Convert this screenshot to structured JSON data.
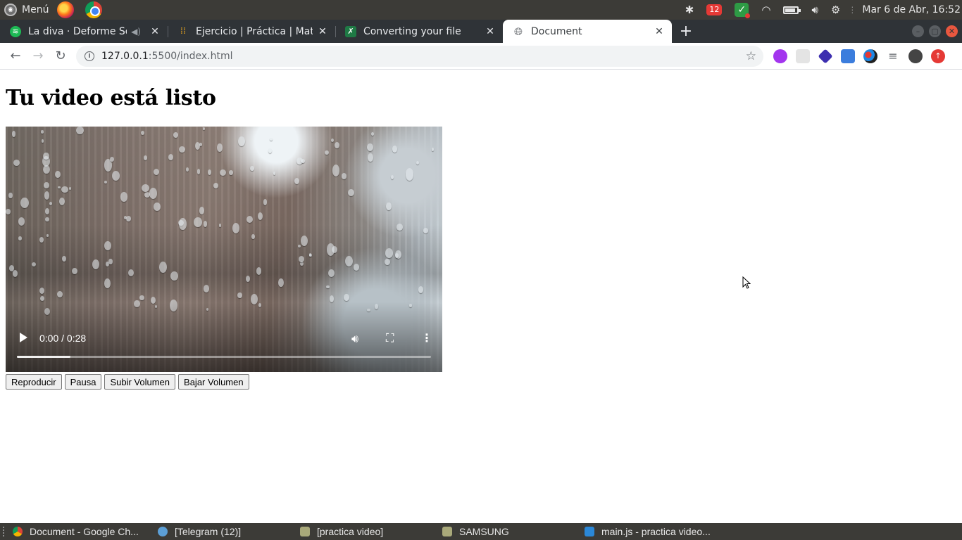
{
  "system_panel": {
    "menu_label": "Menú",
    "clock": "Mar  6 de Abr, 16:52",
    "notification_count": "12",
    "icons": [
      "bluetooth-icon",
      "notification-badge",
      "check-icon",
      "wifi-icon",
      "battery-icon",
      "volume-icon",
      "settings-icon"
    ]
  },
  "browser": {
    "tabs": [
      {
        "title": "La diva · Deforme Sem",
        "favicon": "spotify-icon",
        "has_audio": true
      },
      {
        "title": "Ejercicio | Práctica | Mater",
        "favicon": "platzi-icon"
      },
      {
        "title": "Converting your file",
        "favicon": "spreadsheet-icon"
      },
      {
        "title": "Document",
        "favicon": "globe-icon",
        "active": true
      }
    ],
    "new_tab": "+",
    "address": {
      "host": "127.0.0.1",
      "path": ":5500/index.html"
    }
  },
  "page": {
    "heading": "Tu video está listo",
    "video": {
      "time": "0:00 / 0:28",
      "buffered_fraction": 0.13
    },
    "buttons": {
      "play": "Reproducir",
      "pause": "Pausa",
      "volume_up": "Subir Volumen",
      "volume_down": "Bajar Volumen"
    }
  },
  "taskbar": {
    "items": [
      {
        "label": "Document - Google Ch...",
        "icon": "chrome-icon"
      },
      {
        "label": "[Telegram (12)]",
        "icon": "telegram-icon"
      },
      {
        "label": "[practica video]",
        "icon": "folder-icon"
      },
      {
        "label": "SAMSUNG",
        "icon": "folder-icon"
      },
      {
        "label": "main.js - practica video...",
        "icon": "vscode-icon"
      }
    ]
  }
}
